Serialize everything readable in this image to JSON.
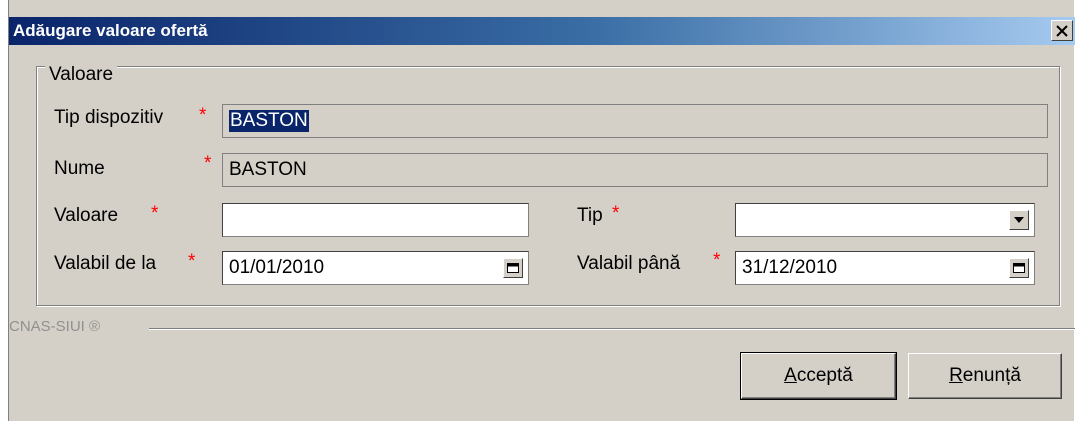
{
  "dialog": {
    "title": "Adăugare valoare ofertă",
    "close_glyph": "×"
  },
  "group": {
    "legend": "Valoare"
  },
  "fields": {
    "tip_dispozitiv": {
      "label": "Tip dispozitiv",
      "required_mark": "*",
      "value": "BASTON"
    },
    "nume": {
      "label": "Nume",
      "required_mark": "*",
      "value": "BASTON"
    },
    "valoare": {
      "label": "Valoare",
      "required_mark": "*",
      "value": ""
    },
    "tip": {
      "label": "Tip",
      "required_mark": "*",
      "value": ""
    },
    "valabil_de_la": {
      "label": "Valabil de la",
      "required_mark": "*",
      "value": "01/01/2010"
    },
    "valabil_pana": {
      "label": "Valabil până",
      "required_mark": "*",
      "value": "31/12/2010"
    }
  },
  "footer": {
    "brand": "CNAS-SIUI ®"
  },
  "buttons": {
    "accept_first": "A",
    "accept_rest": "cceptă",
    "cancel_first": "R",
    "cancel_rest": "enunță"
  },
  "icons": {
    "close": "close-icon",
    "dropdown": "chevron-down-icon",
    "calendar": "calendar-icon"
  },
  "colors": {
    "title_bar_start": "#0a246a",
    "title_bar_end": "#a6caf0",
    "required": "#ff0000",
    "window_bg": "#d4d0c8"
  }
}
